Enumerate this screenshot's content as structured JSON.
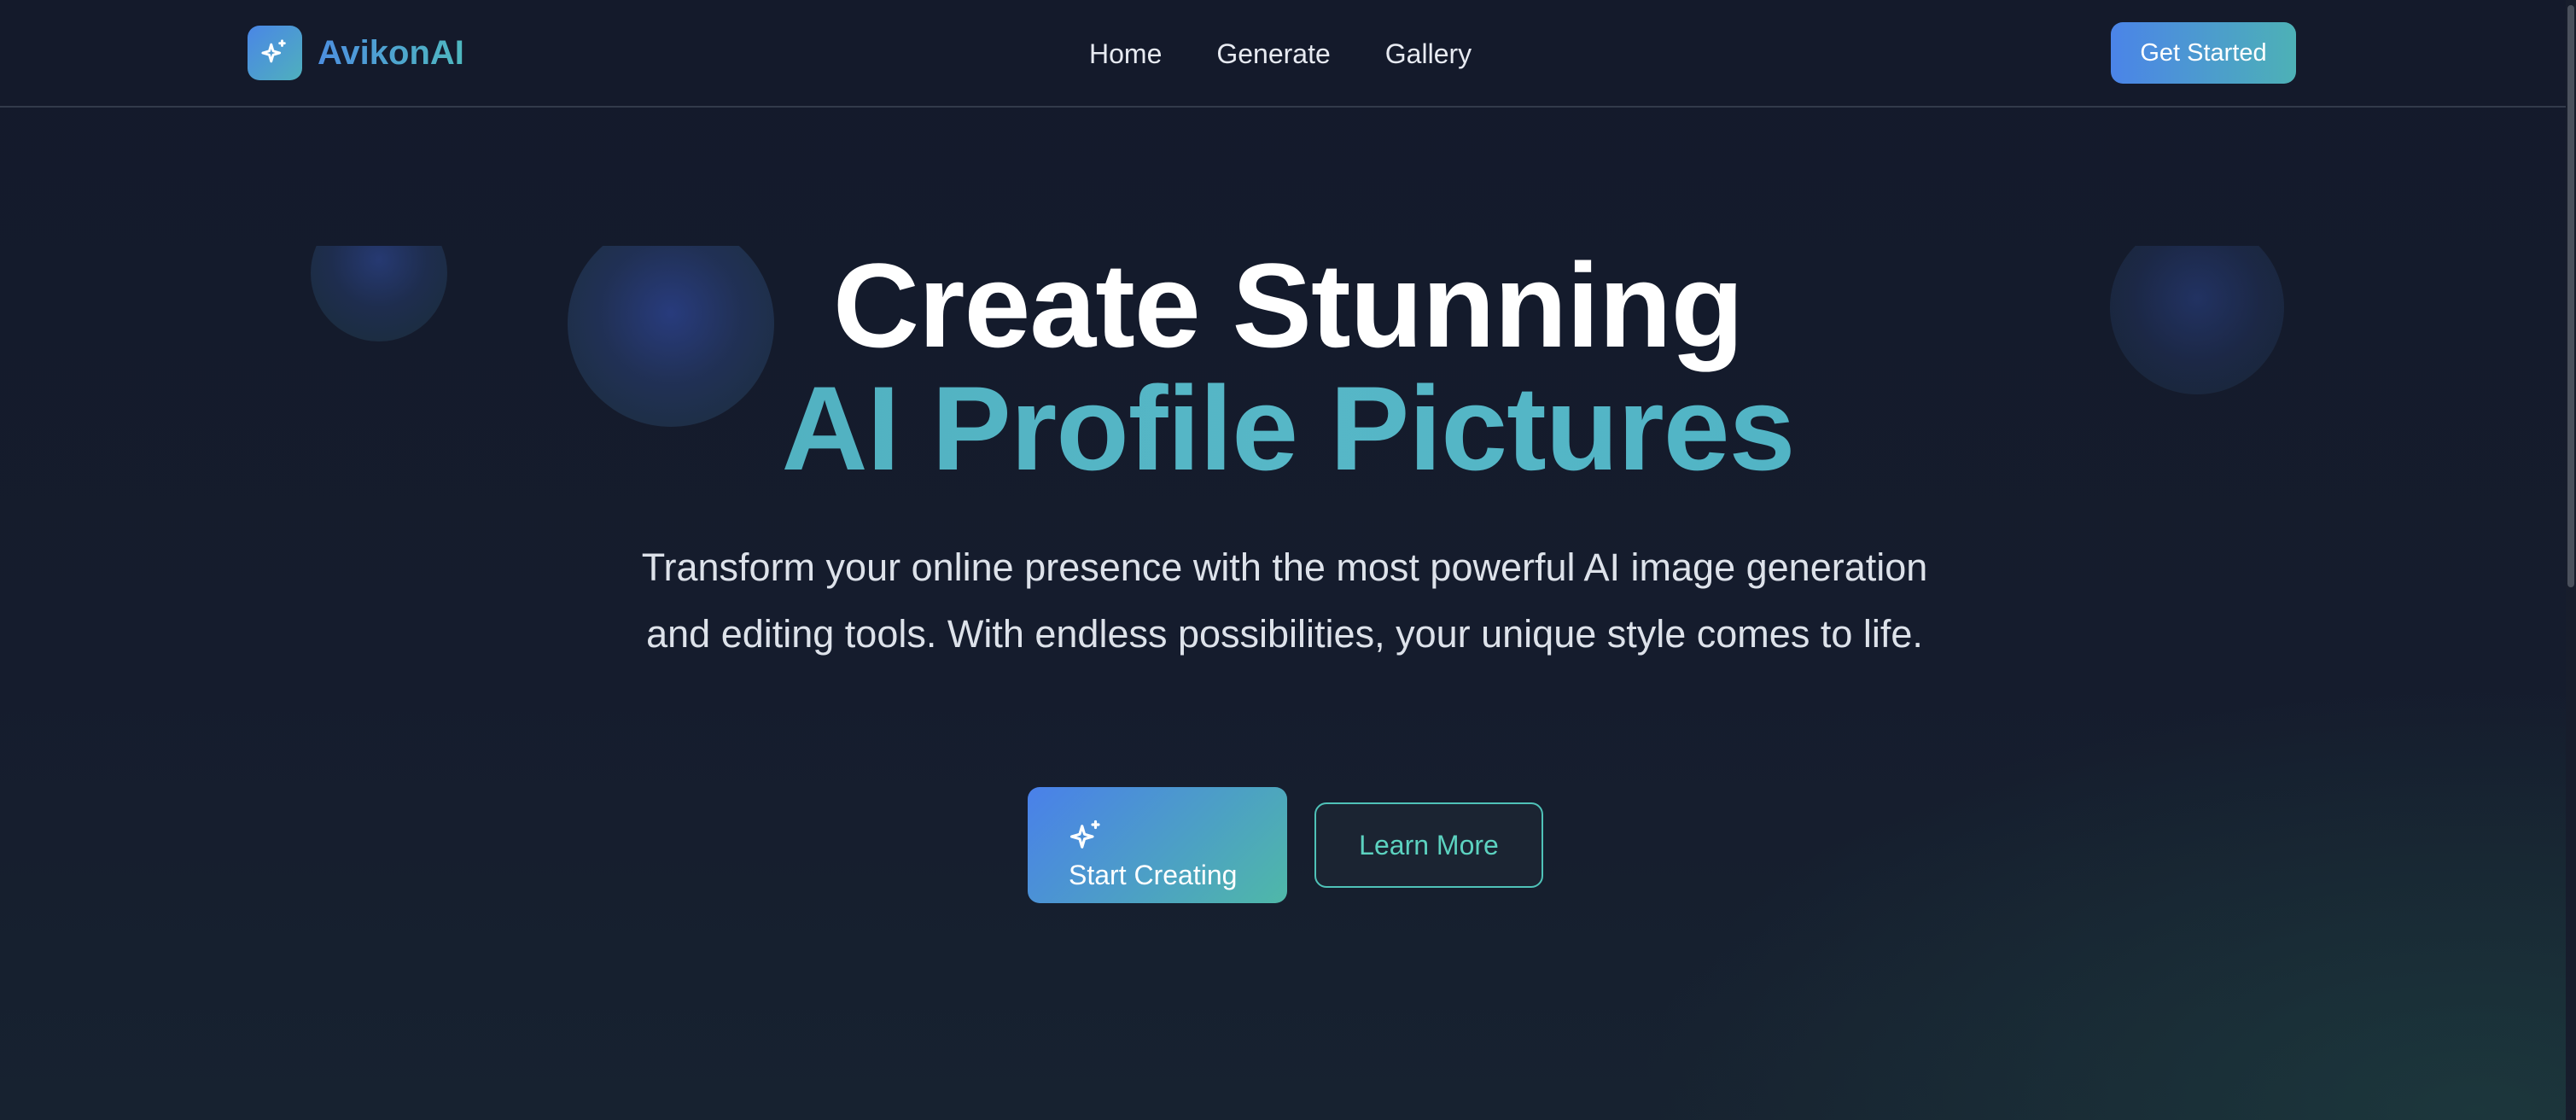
{
  "brand": {
    "name": "AvikonAI",
    "logo_icon": "sparkles-icon"
  },
  "nav": {
    "links": [
      "Home",
      "Generate",
      "Gallery"
    ],
    "cta_label": "Get Started"
  },
  "hero": {
    "title_line1": "Create Stunning",
    "title_line2": "AI Profile Pictures",
    "description": "Transform your online presence with the most powerful AI image generation and editing tools. With endless possibilities, your unique style comes to life.",
    "primary_button": {
      "icon": "sparkles-icon",
      "label": "Start Creating"
    },
    "secondary_button": {
      "label": "Learn More"
    }
  },
  "colors": {
    "background": "#141a2b",
    "accent_blue": "#4a84e8",
    "accent_teal": "#4fb8bf",
    "outline_teal": "#4fc2b8",
    "title_white": "#ffffff"
  }
}
